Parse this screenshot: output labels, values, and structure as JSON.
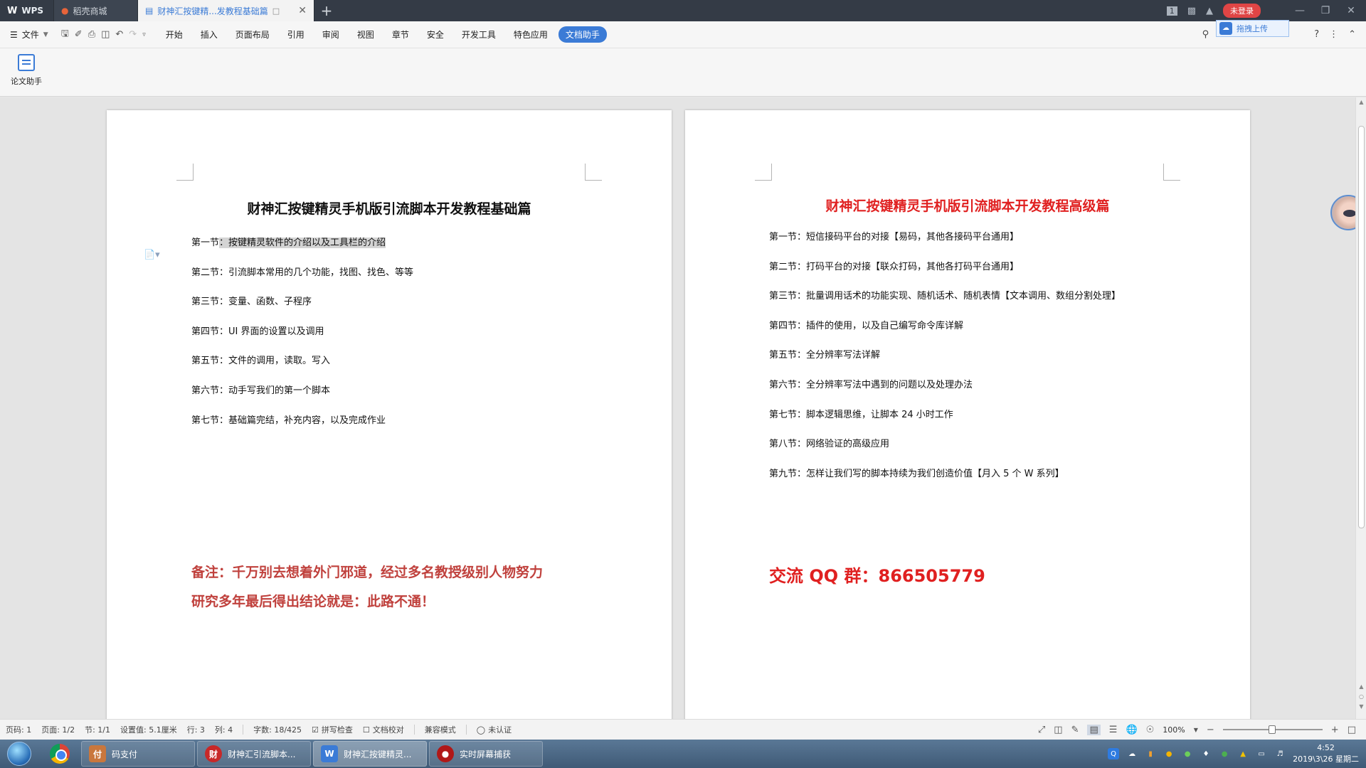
{
  "tabs": [
    {
      "label": "WPS"
    },
    {
      "label": "稻壳商城"
    },
    {
      "label": "财神汇按键精...发教程基础篇"
    }
  ],
  "title_right": {
    "page_badge": "1",
    "login_label": "未登录"
  },
  "menu": {
    "file_label": "文件",
    "items": [
      "开始",
      "插入",
      "页面布局",
      "引用",
      "审阅",
      "视图",
      "章节",
      "安全",
      "开发工具",
      "特色应用",
      "文档助手"
    ],
    "help": "?",
    "upload_label": "拖拽上传"
  },
  "ribbon": {
    "thesis_assistant": "论文助手"
  },
  "page1": {
    "title": "财神汇按键精灵手机版引流脚本开发教程基础篇",
    "sections": [
      {
        "prefix": "第一节",
        "text": "：按键精灵软件的介绍以及工具栏的介绍"
      },
      {
        "prefix": "第二节",
        "text": "：引流脚本常用的几个功能，找图、找色、等等"
      },
      {
        "prefix": "第三节",
        "text": "：变量、函数、子程序"
      },
      {
        "prefix": "第四节",
        "text": "：UI 界面的设置以及调用"
      },
      {
        "prefix": "第五节",
        "text": "：文件的调用，读取。写入"
      },
      {
        "prefix": "第六节",
        "text": "：动手写我们的第一个脚本"
      },
      {
        "prefix": "第七节",
        "text": "：基础篇完结，补充内容，以及完成作业"
      }
    ],
    "note_line1": "备注：千万别去想着外门邪道，经过多名教授级别人物努力",
    "note_line2": "研究多年最后得出结论就是：此路不通！"
  },
  "page2": {
    "title": "财神汇按键精灵手机版引流脚本开发教程高级篇",
    "sections": [
      "第一节：短信接码平台的对接【易码，其他各接码平台通用】",
      "第二节：打码平台的对接【联众打码，其他各打码平台通用】",
      "第三节：批量调用话术的功能实现、随机话术、随机表情【文本调用、数组分割处理】",
      "第四节：插件的使用，以及自己编写命令库详解",
      "第五节：全分辨率写法详解",
      "第六节：全分辨率写法中遇到的问题以及处理办法",
      "第七节：脚本逻辑思维，让脚本 24 小时工作",
      "第八节：网络验证的高级应用",
      "第九节：怎样让我们写的脚本持续为我们创造价值【月入 5 个 W 系列】"
    ],
    "qq_group": "交流 QQ 群：866505779"
  },
  "status": {
    "page_num": "页码: 1",
    "pages": "页面: 1/2",
    "section": "节: 1/1",
    "setting": "设置值: 5.1厘米",
    "row": "行: 3",
    "col": "列: 4",
    "words": "字数: 18/425",
    "spell": "拼写检查",
    "proof": "文档校对",
    "compat": "兼容模式",
    "cert": "未认证",
    "zoom": "100%"
  },
  "taskbar": {
    "tasks": [
      "码支付",
      "财神汇引流脚本...",
      "财神汇按键精灵...",
      "实时屏幕捕获"
    ],
    "time": "4:52",
    "date": "2019\\3\\26 星期二"
  },
  "colors": {
    "accent": "#3b7bd6",
    "red_title": "#e02020",
    "note_red": "#c0413d"
  },
  "icons": [
    "wps-logo",
    "daoke-icon",
    "doc-icon",
    "save-icon",
    "print-icon",
    "undo-icon",
    "redo-icon",
    "search-icon",
    "cloud-icon",
    "chrome-icon",
    "windows-orb"
  ]
}
